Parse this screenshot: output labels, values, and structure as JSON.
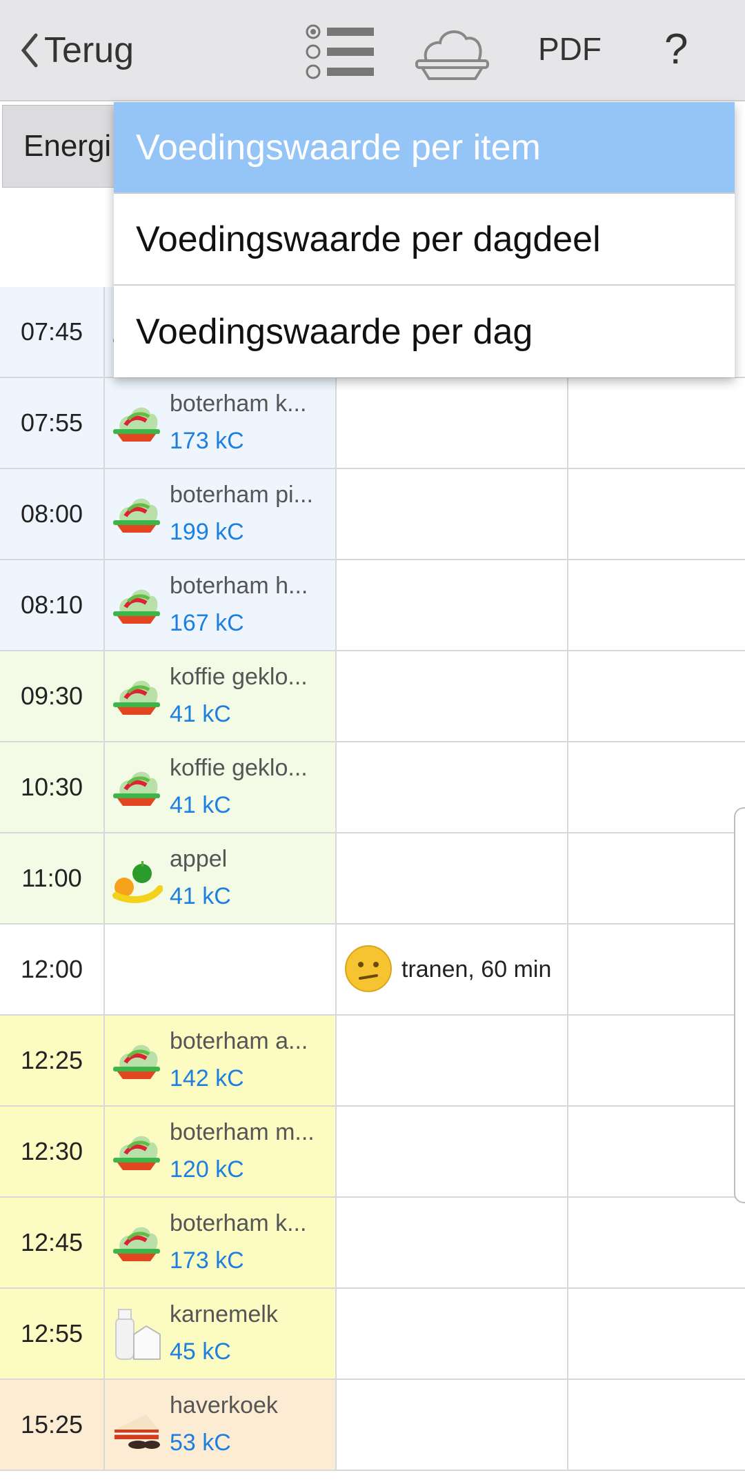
{
  "header": {
    "back_label": "Terug",
    "list_icon": "list-icon",
    "meal_icon": "meal-cover-icon",
    "pdf_label": "PDF",
    "help_label": "?"
  },
  "tabs": {
    "energy_label": "Energi"
  },
  "dropdown": {
    "items": [
      {
        "label": "Voedingswaarde per item",
        "selected": true
      },
      {
        "label": "Voedingswaarde per dagdeel",
        "selected": false
      },
      {
        "label": "Voedingswaarde per dag",
        "selected": false
      }
    ]
  },
  "colors": {
    "morning": "#eef5fd",
    "midmorning": "#f3fbe6",
    "lunch": "#fcfbc2",
    "afternoon": "#fdecd4",
    "kcal_blue": "#1d7fe0",
    "selected_item": "#95c4f7"
  },
  "rows": [
    {
      "time": "07:45",
      "name": "",
      "kc": "",
      "icon": "meal-icon",
      "tint": "morning"
    },
    {
      "time": "07:55",
      "name": "boterham k...",
      "kc": "173 kC",
      "icon": "meal-icon",
      "tint": "morning"
    },
    {
      "time": "08:00",
      "name": "boterham pi...",
      "kc": "199 kC",
      "icon": "meal-icon",
      "tint": "morning"
    },
    {
      "time": "08:10",
      "name": "boterham h...",
      "kc": "167 kC",
      "icon": "meal-icon",
      "tint": "morning"
    },
    {
      "time": "09:30",
      "name": "koffie geklo...",
      "kc": "41 kC",
      "icon": "meal-icon",
      "tint": "midmorning"
    },
    {
      "time": "10:30",
      "name": "koffie geklo...",
      "kc": "41 kC",
      "icon": "meal-icon",
      "tint": "midmorning"
    },
    {
      "time": "11:00",
      "name": "appel",
      "kc": "41 kC",
      "icon": "fruit-icon",
      "tint": "midmorning"
    },
    {
      "time": "12:00",
      "name": "",
      "kc": "",
      "icon": "",
      "tint": "none",
      "mood": "tranen, 60 min",
      "mood_icon": "confused-face-icon"
    },
    {
      "time": "12:25",
      "name": "boterham a...",
      "kc": "142 kC",
      "icon": "meal-icon",
      "tint": "lunch"
    },
    {
      "time": "12:30",
      "name": "boterham m...",
      "kc": "120 kC",
      "icon": "meal-icon",
      "tint": "lunch"
    },
    {
      "time": "12:45",
      "name": "boterham k...",
      "kc": "173 kC",
      "icon": "meal-icon",
      "tint": "lunch"
    },
    {
      "time": "12:55",
      "name": "karnemelk",
      "kc": "45 kC",
      "icon": "milk-icon",
      "tint": "lunch"
    },
    {
      "time": "15:25",
      "name": "haverkoek",
      "kc": "53 kC",
      "icon": "cake-icon",
      "tint": "afternoon"
    }
  ]
}
